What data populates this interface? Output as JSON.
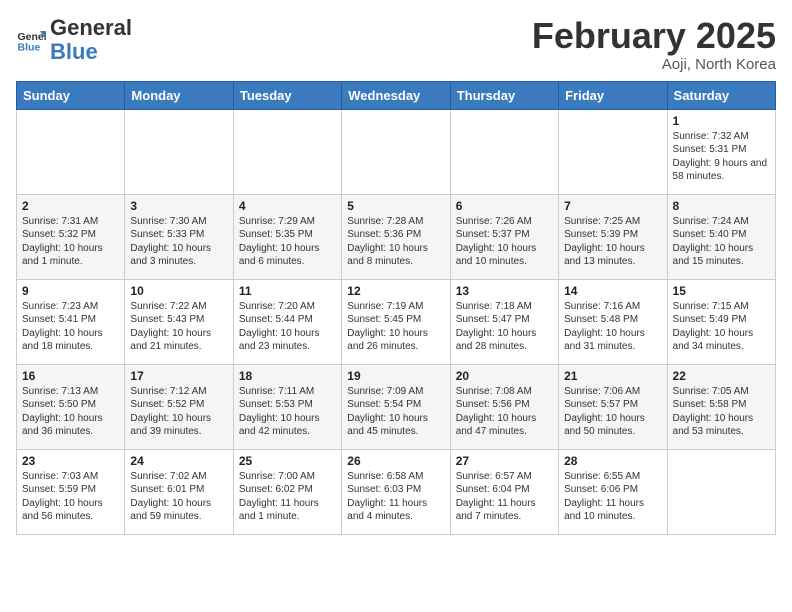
{
  "header": {
    "logo_general": "General",
    "logo_blue": "Blue",
    "month_title": "February 2025",
    "location": "Aoji, North Korea"
  },
  "days_of_week": [
    "Sunday",
    "Monday",
    "Tuesday",
    "Wednesday",
    "Thursday",
    "Friday",
    "Saturday"
  ],
  "weeks": [
    [
      {
        "day": "",
        "info": ""
      },
      {
        "day": "",
        "info": ""
      },
      {
        "day": "",
        "info": ""
      },
      {
        "day": "",
        "info": ""
      },
      {
        "day": "",
        "info": ""
      },
      {
        "day": "",
        "info": ""
      },
      {
        "day": "1",
        "info": "Sunrise: 7:32 AM\nSunset: 5:31 PM\nDaylight: 9 hours and 58 minutes."
      }
    ],
    [
      {
        "day": "2",
        "info": "Sunrise: 7:31 AM\nSunset: 5:32 PM\nDaylight: 10 hours and 1 minute."
      },
      {
        "day": "3",
        "info": "Sunrise: 7:30 AM\nSunset: 5:33 PM\nDaylight: 10 hours and 3 minutes."
      },
      {
        "day": "4",
        "info": "Sunrise: 7:29 AM\nSunset: 5:35 PM\nDaylight: 10 hours and 6 minutes."
      },
      {
        "day": "5",
        "info": "Sunrise: 7:28 AM\nSunset: 5:36 PM\nDaylight: 10 hours and 8 minutes."
      },
      {
        "day": "6",
        "info": "Sunrise: 7:26 AM\nSunset: 5:37 PM\nDaylight: 10 hours and 10 minutes."
      },
      {
        "day": "7",
        "info": "Sunrise: 7:25 AM\nSunset: 5:39 PM\nDaylight: 10 hours and 13 minutes."
      },
      {
        "day": "8",
        "info": "Sunrise: 7:24 AM\nSunset: 5:40 PM\nDaylight: 10 hours and 15 minutes."
      }
    ],
    [
      {
        "day": "9",
        "info": "Sunrise: 7:23 AM\nSunset: 5:41 PM\nDaylight: 10 hours and 18 minutes."
      },
      {
        "day": "10",
        "info": "Sunrise: 7:22 AM\nSunset: 5:43 PM\nDaylight: 10 hours and 21 minutes."
      },
      {
        "day": "11",
        "info": "Sunrise: 7:20 AM\nSunset: 5:44 PM\nDaylight: 10 hours and 23 minutes."
      },
      {
        "day": "12",
        "info": "Sunrise: 7:19 AM\nSunset: 5:45 PM\nDaylight: 10 hours and 26 minutes."
      },
      {
        "day": "13",
        "info": "Sunrise: 7:18 AM\nSunset: 5:47 PM\nDaylight: 10 hours and 28 minutes."
      },
      {
        "day": "14",
        "info": "Sunrise: 7:16 AM\nSunset: 5:48 PM\nDaylight: 10 hours and 31 minutes."
      },
      {
        "day": "15",
        "info": "Sunrise: 7:15 AM\nSunset: 5:49 PM\nDaylight: 10 hours and 34 minutes."
      }
    ],
    [
      {
        "day": "16",
        "info": "Sunrise: 7:13 AM\nSunset: 5:50 PM\nDaylight: 10 hours and 36 minutes."
      },
      {
        "day": "17",
        "info": "Sunrise: 7:12 AM\nSunset: 5:52 PM\nDaylight: 10 hours and 39 minutes."
      },
      {
        "day": "18",
        "info": "Sunrise: 7:11 AM\nSunset: 5:53 PM\nDaylight: 10 hours and 42 minutes."
      },
      {
        "day": "19",
        "info": "Sunrise: 7:09 AM\nSunset: 5:54 PM\nDaylight: 10 hours and 45 minutes."
      },
      {
        "day": "20",
        "info": "Sunrise: 7:08 AM\nSunset: 5:56 PM\nDaylight: 10 hours and 47 minutes."
      },
      {
        "day": "21",
        "info": "Sunrise: 7:06 AM\nSunset: 5:57 PM\nDaylight: 10 hours and 50 minutes."
      },
      {
        "day": "22",
        "info": "Sunrise: 7:05 AM\nSunset: 5:58 PM\nDaylight: 10 hours and 53 minutes."
      }
    ],
    [
      {
        "day": "23",
        "info": "Sunrise: 7:03 AM\nSunset: 5:59 PM\nDaylight: 10 hours and 56 minutes."
      },
      {
        "day": "24",
        "info": "Sunrise: 7:02 AM\nSunset: 6:01 PM\nDaylight: 10 hours and 59 minutes."
      },
      {
        "day": "25",
        "info": "Sunrise: 7:00 AM\nSunset: 6:02 PM\nDaylight: 11 hours and 1 minute."
      },
      {
        "day": "26",
        "info": "Sunrise: 6:58 AM\nSunset: 6:03 PM\nDaylight: 11 hours and 4 minutes."
      },
      {
        "day": "27",
        "info": "Sunrise: 6:57 AM\nSunset: 6:04 PM\nDaylight: 11 hours and 7 minutes."
      },
      {
        "day": "28",
        "info": "Sunrise: 6:55 AM\nSunset: 6:06 PM\nDaylight: 11 hours and 10 minutes."
      },
      {
        "day": "",
        "info": ""
      }
    ]
  ]
}
